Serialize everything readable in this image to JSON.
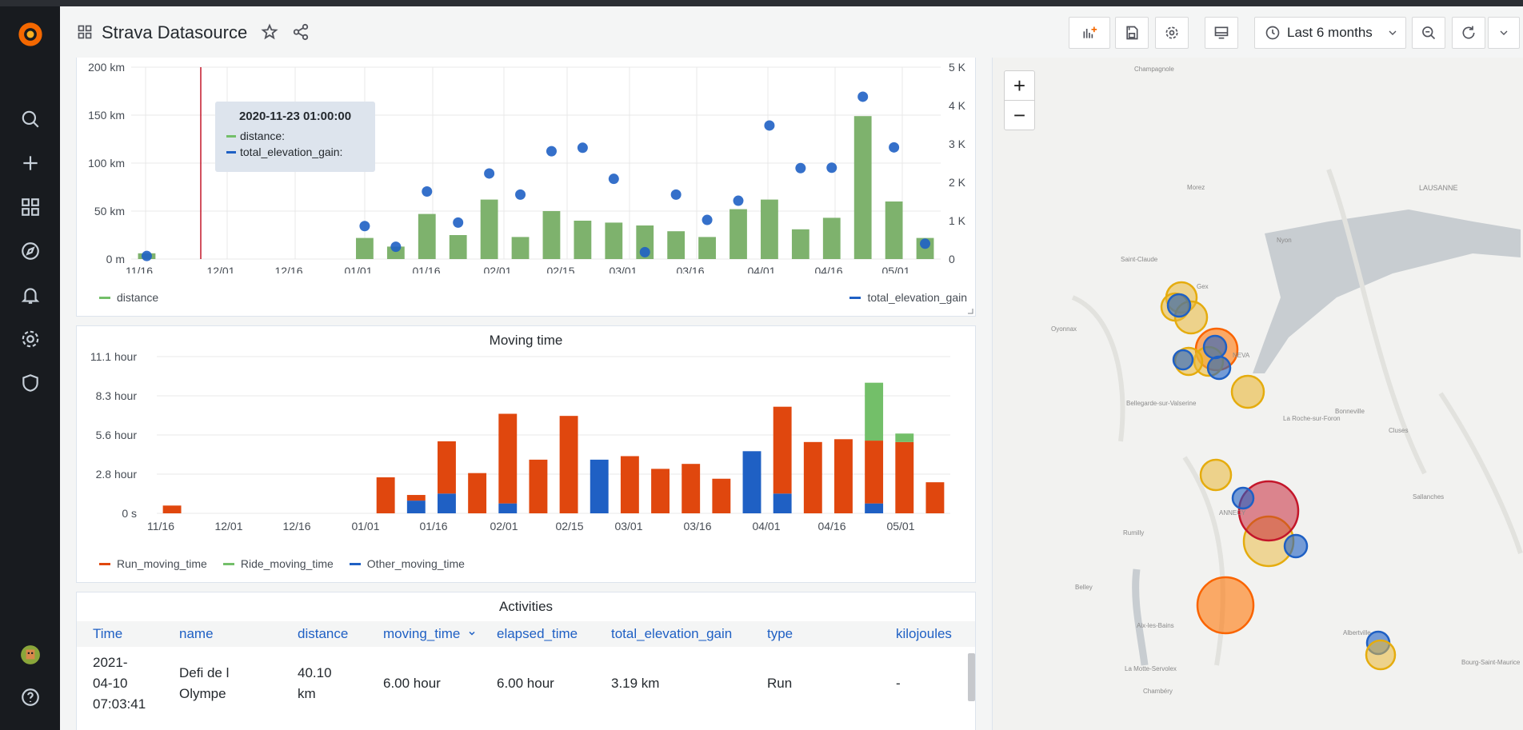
{
  "dashboard": {
    "title": "Strava Datasource",
    "time_range": "Last 6 months"
  },
  "panel_distance": {
    "y_left_ticks": [
      "200 km",
      "150 km",
      "100 km",
      "50 km",
      "0 m"
    ],
    "y_right_ticks": [
      "5 K",
      "4 K",
      "3 K",
      "2 K",
      "1 K",
      "0"
    ],
    "x_ticks": [
      "11/16",
      "12/01",
      "12/16",
      "01/01",
      "01/16",
      "02/01",
      "02/15",
      "03/01",
      "03/16",
      "04/01",
      "04/16",
      "05/01"
    ],
    "legend": {
      "left": "distance",
      "right": "total_elevation_gain"
    },
    "tooltip": {
      "time": "2020-11-23 01:00:00",
      "row1": "distance:",
      "row2": "total_elevation_gain:"
    }
  },
  "panel_moving": {
    "title": "Moving time",
    "y_ticks": [
      "11.1 hour",
      "8.3 hour",
      "5.6 hour",
      "2.8 hour",
      "0 s"
    ],
    "x_ticks": [
      "11/16",
      "12/01",
      "12/16",
      "01/01",
      "01/16",
      "02/01",
      "02/15",
      "03/01",
      "03/16",
      "04/01",
      "04/16",
      "05/01"
    ],
    "legend": [
      "Run_moving_time",
      "Ride_moving_time",
      "Other_moving_time"
    ]
  },
  "panel_table": {
    "title": "Activities",
    "columns": [
      "Time",
      "name",
      "distance",
      "moving_time",
      "elapsed_time",
      "total_elevation_gain",
      "type",
      "kilojoules"
    ],
    "row": {
      "time_1": "2021-",
      "time_2": "04-10",
      "time_3": "07:03:41",
      "name_1": "Defi de l",
      "name_2": "Olympe",
      "distance_1": "40.10",
      "distance_2": "km",
      "moving_time": "6.00 hour",
      "elapsed_time": "6.00 hour",
      "total_elevation_gain": "3.19 km",
      "type": "Run",
      "kilojoules": "-"
    }
  },
  "map": {
    "zoom_in": "+",
    "zoom_out": "−",
    "places": [
      "Champagnole",
      "LAUSANNE",
      "Morez",
      "Nyon",
      "Saint-Claude",
      "Gex",
      "Oyonnax",
      "NEVA",
      "Bellegarde-sur-Valserine",
      "La Roche-sur-Foron",
      "Bonneville",
      "Cluses",
      "ANNECY",
      "Rumilly",
      "Sallanches",
      "Belley",
      "Albertville",
      "Bourg-Saint-Maurice",
      "Chambéry",
      "La Motte-Servolex",
      "Aix-les-Bains"
    ]
  },
  "colors": {
    "green": "#73bf69",
    "blue": "#1f60c4",
    "orange": "#e0470e",
    "yellow": "#e8c41b",
    "red": "#c4162a"
  },
  "chart_data": [
    {
      "type": "bar",
      "title": "",
      "categories": [
        "11/16",
        "11/23",
        "11/30",
        "12/07",
        "12/14",
        "12/21",
        "12/28",
        "01/04",
        "01/11",
        "01/18",
        "01/25",
        "02/01",
        "02/08",
        "02/15",
        "02/22",
        "03/01",
        "03/08",
        "03/15",
        "03/22",
        "03/29",
        "04/05",
        "04/12",
        "04/19",
        "04/26",
        "05/03",
        "05/10"
      ],
      "series": [
        {
          "name": "distance",
          "axis": "left",
          "values_km": [
            6,
            0,
            0,
            0,
            0,
            0,
            0,
            22,
            13,
            47,
            25,
            62,
            23,
            50,
            40,
            38,
            35,
            29,
            23,
            52,
            62,
            31,
            43,
            149,
            60,
            22
          ]
        },
        {
          "name": "total_elevation_gain",
          "axis": "right",
          "type": "scatter",
          "values": [
            80,
            null,
            null,
            null,
            null,
            null,
            null,
            860,
            320,
            1760,
            950,
            2230,
            1680,
            2810,
            2900,
            2090,
            180,
            1680,
            1020,
            1520,
            3480,
            2370,
            2380,
            4230,
            2910,
            400
          ]
        }
      ],
      "ylim_left_km": [
        0,
        200
      ],
      "ylim_right": [
        0,
        5000
      ]
    },
    {
      "type": "bar",
      "title": "Moving time",
      "stacked": true,
      "categories": [
        "11/16",
        "11/23",
        "11/30",
        "12/07",
        "12/14",
        "12/21",
        "12/28",
        "01/04",
        "01/11",
        "01/18",
        "01/25",
        "02/01",
        "02/08",
        "02/15",
        "02/22",
        "03/01",
        "03/08",
        "03/15",
        "03/22",
        "03/29",
        "04/05",
        "04/12",
        "04/19",
        "04/26",
        "05/03",
        "05/10"
      ],
      "series": [
        {
          "name": "Other_moving_time",
          "values_hours": [
            0,
            0,
            0,
            0,
            0,
            0,
            0,
            0,
            0.9,
            1.4,
            0,
            0.7,
            0,
            0,
            3.8,
            0,
            0,
            0,
            0,
            4.4,
            1.4,
            0,
            0,
            0.7,
            0,
            0
          ]
        },
        {
          "name": "Run_moving_time",
          "values_hours": [
            0.55,
            0,
            0,
            0,
            0,
            0,
            0,
            2.55,
            0.4,
            3.7,
            2.85,
            6.35,
            3.8,
            6.9,
            0,
            4.05,
            3.15,
            3.5,
            2.45,
            0,
            6.15,
            5.05,
            5.25,
            4.45,
            5.05,
            2.2
          ]
        },
        {
          "name": "Ride_moving_time",
          "values_hours": [
            0,
            0,
            0,
            0,
            0,
            0,
            0,
            0,
            0,
            0,
            0,
            0,
            0,
            0,
            0,
            0,
            0,
            0,
            0,
            0,
            0,
            0,
            0,
            4.1,
            0.6,
            0
          ]
        }
      ],
      "ylim_hours": [
        0,
        11.1
      ]
    }
  ]
}
